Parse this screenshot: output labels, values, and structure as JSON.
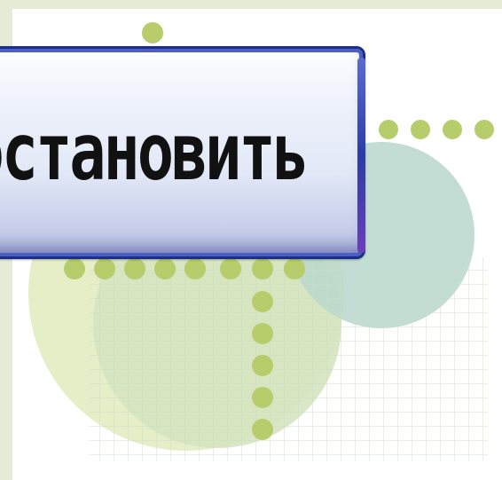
{
  "button": {
    "label": "остановить",
    "icon": "none"
  },
  "colors": {
    "background": "#ffffff",
    "band": "#e4ecd6",
    "dot": "#b7cc6b",
    "circle_light": "#d9e5b6",
    "circle_teal": "#a8cdbf",
    "grid": "#cfdfcf",
    "button_border": "#1d2e8a",
    "button_face": "#e2e8f7"
  },
  "decor": {
    "pattern": "dots-circles-grid"
  }
}
